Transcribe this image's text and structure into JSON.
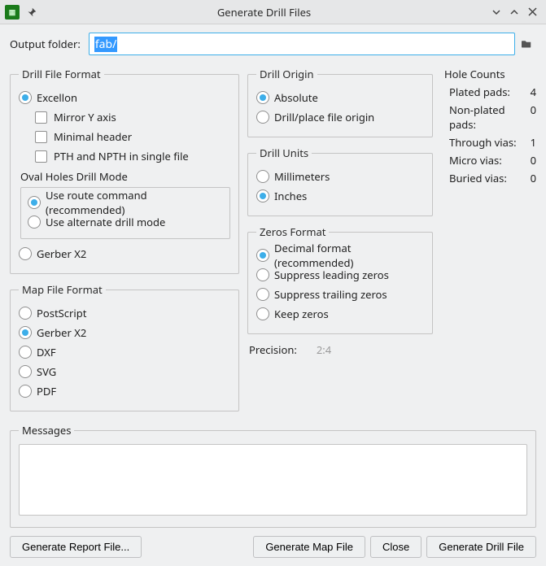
{
  "window": {
    "title": "Generate Drill Files"
  },
  "output": {
    "label": "Output folder:",
    "value": "fab/"
  },
  "drill_format": {
    "legend": "Drill File Format",
    "excellon": "Excellon",
    "mirror_y": "Mirror Y axis",
    "minimal_header": "Minimal header",
    "pth_npth": "PTH and NPTH in single file",
    "oval_mode_label": "Oval Holes Drill Mode",
    "use_route": "Use route command (recommended)",
    "use_alt": "Use alternate drill mode",
    "gerber_x2": "Gerber X2"
  },
  "map_format": {
    "legend": "Map File Format",
    "postscript": "PostScript",
    "gerber_x2": "Gerber X2",
    "dxf": "DXF",
    "svg": "SVG",
    "pdf": "PDF"
  },
  "drill_origin": {
    "legend": "Drill Origin",
    "absolute": "Absolute",
    "file_origin": "Drill/place file origin"
  },
  "drill_units": {
    "legend": "Drill Units",
    "mm": "Millimeters",
    "in": "Inches"
  },
  "zeros": {
    "legend": "Zeros Format",
    "decimal": "Decimal format (recommended)",
    "sup_lead": "Suppress leading zeros",
    "sup_trail": "Suppress trailing zeros",
    "keep": "Keep zeros"
  },
  "precision": {
    "label": "Precision:",
    "value": "2:4"
  },
  "hole_counts": {
    "title": "Hole Counts",
    "plated_label": "Plated pads:",
    "plated_value": "4",
    "nonplated_label": "Non-plated pads:",
    "nonplated_value": "0",
    "through_label": "Through vias:",
    "through_value": "1",
    "micro_label": "Micro vias:",
    "micro_value": "0",
    "buried_label": "Buried vias:",
    "buried_value": "0"
  },
  "messages": {
    "legend": "Messages",
    "content": ""
  },
  "buttons": {
    "report": "Generate Report File...",
    "map": "Generate Map File",
    "close": "Close",
    "drill": "Generate Drill File"
  }
}
